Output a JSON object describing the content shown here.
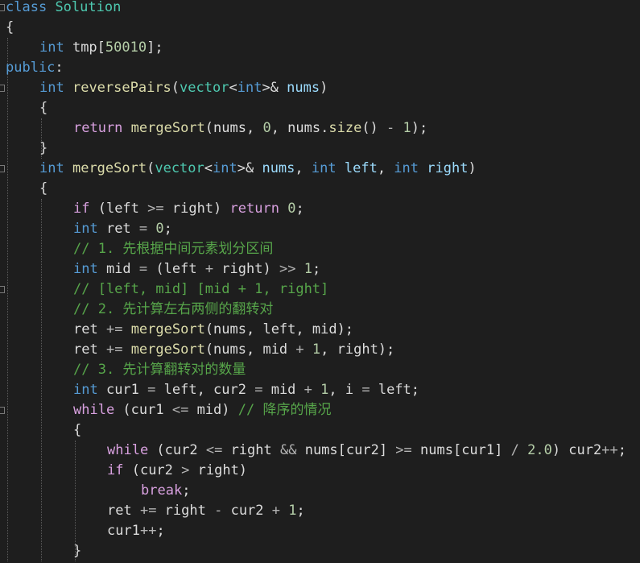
{
  "colors": {
    "background": "#1e1e1e",
    "keyword": "#569cd6",
    "control": "#d8a0df",
    "type": "#4ec9b0",
    "function": "#dcdcaa",
    "variable": "#9cdcfe",
    "number": "#b5cea8",
    "comment": "#57a64a",
    "operator": "#b4b4b4",
    "plain": "#dcdcdc"
  },
  "lines": [
    {
      "indent": 0,
      "fold": true,
      "tokens": [
        [
          "class",
          "kw"
        ],
        [
          " ",
          "plain"
        ],
        [
          "Solution",
          "type"
        ]
      ]
    },
    {
      "indent": 0,
      "fold": false,
      "tokens": [
        [
          "{",
          "plain"
        ]
      ]
    },
    {
      "indent": 1,
      "fold": false,
      "tokens": [
        [
          "int",
          "kw"
        ],
        [
          " tmp[",
          "plain"
        ],
        [
          "50010",
          "num"
        ],
        [
          "];",
          "plain"
        ]
      ]
    },
    {
      "indent": 0,
      "fold": false,
      "tokens": [
        [
          "public",
          "kw"
        ],
        [
          ":",
          "plain"
        ]
      ]
    },
    {
      "indent": 1,
      "fold": true,
      "tokens": [
        [
          "int",
          "kw"
        ],
        [
          " ",
          "plain"
        ],
        [
          "reversePairs",
          "fn"
        ],
        [
          "(",
          "plain"
        ],
        [
          "vector",
          "type"
        ],
        [
          "<",
          "plain"
        ],
        [
          "int",
          "kw"
        ],
        [
          ">& ",
          "plain"
        ],
        [
          "nums",
          "var"
        ],
        [
          ")",
          "plain"
        ]
      ]
    },
    {
      "indent": 1,
      "fold": false,
      "tokens": [
        [
          "{",
          "plain"
        ]
      ]
    },
    {
      "indent": 2,
      "fold": false,
      "tokens": [
        [
          "return",
          "ctl"
        ],
        [
          " ",
          "plain"
        ],
        [
          "mergeSort",
          "fn"
        ],
        [
          "(nums, ",
          "plain"
        ],
        [
          "0",
          "num"
        ],
        [
          ", nums.",
          "plain"
        ],
        [
          "size",
          "fn"
        ],
        [
          "() ",
          "plain"
        ],
        [
          "-",
          "op"
        ],
        [
          " ",
          "plain"
        ],
        [
          "1",
          "num"
        ],
        [
          ");",
          "plain"
        ]
      ]
    },
    {
      "indent": 1,
      "fold": false,
      "tokens": [
        [
          "}",
          "plain"
        ]
      ]
    },
    {
      "indent": 1,
      "fold": true,
      "tokens": [
        [
          "int",
          "kw"
        ],
        [
          " ",
          "plain"
        ],
        [
          "mergeSort",
          "fn"
        ],
        [
          "(",
          "plain"
        ],
        [
          "vector",
          "type"
        ],
        [
          "<",
          "plain"
        ],
        [
          "int",
          "kw"
        ],
        [
          ">& ",
          "plain"
        ],
        [
          "nums",
          "var"
        ],
        [
          ", ",
          "plain"
        ],
        [
          "int",
          "kw"
        ],
        [
          " ",
          "plain"
        ],
        [
          "left",
          "var"
        ],
        [
          ", ",
          "plain"
        ],
        [
          "int",
          "kw"
        ],
        [
          " ",
          "plain"
        ],
        [
          "right",
          "var"
        ],
        [
          ")",
          "plain"
        ]
      ]
    },
    {
      "indent": 1,
      "fold": false,
      "tokens": [
        [
          "{",
          "plain"
        ]
      ]
    },
    {
      "indent": 2,
      "fold": false,
      "tokens": [
        [
          "if",
          "ctl"
        ],
        [
          " (left ",
          "plain"
        ],
        [
          ">=",
          "op"
        ],
        [
          " right) ",
          "plain"
        ],
        [
          "return",
          "ctl"
        ],
        [
          " ",
          "plain"
        ],
        [
          "0",
          "num"
        ],
        [
          ";",
          "plain"
        ]
      ]
    },
    {
      "indent": 2,
      "fold": false,
      "tokens": [
        [
          "int",
          "kw"
        ],
        [
          " ret ",
          "plain"
        ],
        [
          "=",
          "op"
        ],
        [
          " ",
          "plain"
        ],
        [
          "0",
          "num"
        ],
        [
          ";",
          "plain"
        ]
      ]
    },
    {
      "indent": 2,
      "fold": false,
      "tokens": [
        [
          "// 1. 先根据中间元素划分区间",
          "cmt"
        ]
      ]
    },
    {
      "indent": 2,
      "fold": false,
      "tokens": [
        [
          "int",
          "kw"
        ],
        [
          " mid ",
          "plain"
        ],
        [
          "=",
          "op"
        ],
        [
          " (left ",
          "plain"
        ],
        [
          "+",
          "op"
        ],
        [
          " right) ",
          "plain"
        ],
        [
          ">>",
          "op"
        ],
        [
          " ",
          "plain"
        ],
        [
          "1",
          "num"
        ],
        [
          ";",
          "plain"
        ]
      ]
    },
    {
      "indent": 2,
      "fold": true,
      "tokens": [
        [
          "// [left, mid] [mid + 1, right]",
          "cmt"
        ]
      ]
    },
    {
      "indent": 2,
      "fold": false,
      "tokens": [
        [
          "// 2. 先计算左右两侧的翻转对",
          "cmt"
        ]
      ]
    },
    {
      "indent": 2,
      "fold": false,
      "tokens": [
        [
          "ret ",
          "plain"
        ],
        [
          "+=",
          "op"
        ],
        [
          " ",
          "plain"
        ],
        [
          "mergeSort",
          "fn"
        ],
        [
          "(nums, left, mid);",
          "plain"
        ]
      ]
    },
    {
      "indent": 2,
      "fold": false,
      "tokens": [
        [
          "ret ",
          "plain"
        ],
        [
          "+=",
          "op"
        ],
        [
          " ",
          "plain"
        ],
        [
          "mergeSort",
          "fn"
        ],
        [
          "(nums, mid ",
          "plain"
        ],
        [
          "+",
          "op"
        ],
        [
          " ",
          "plain"
        ],
        [
          "1",
          "num"
        ],
        [
          ", right);",
          "plain"
        ]
      ]
    },
    {
      "indent": 2,
      "fold": false,
      "tokens": [
        [
          "// 3. 先计算翻转对的数量",
          "cmt"
        ]
      ]
    },
    {
      "indent": 2,
      "fold": false,
      "tokens": [
        [
          "int",
          "kw"
        ],
        [
          " cur1 ",
          "plain"
        ],
        [
          "=",
          "op"
        ],
        [
          " left, cur2 ",
          "plain"
        ],
        [
          "=",
          "op"
        ],
        [
          " mid ",
          "plain"
        ],
        [
          "+",
          "op"
        ],
        [
          " ",
          "plain"
        ],
        [
          "1",
          "num"
        ],
        [
          ", i ",
          "plain"
        ],
        [
          "=",
          "op"
        ],
        [
          " left;",
          "plain"
        ]
      ]
    },
    {
      "indent": 2,
      "fold": true,
      "tokens": [
        [
          "while",
          "ctl"
        ],
        [
          " (cur1 ",
          "plain"
        ],
        [
          "<=",
          "op"
        ],
        [
          " mid) ",
          "plain"
        ],
        [
          "// 降序的情况",
          "cmt"
        ]
      ]
    },
    {
      "indent": 2,
      "fold": false,
      "tokens": [
        [
          "{",
          "plain"
        ]
      ]
    },
    {
      "indent": 3,
      "fold": false,
      "tokens": [
        [
          "while",
          "ctl"
        ],
        [
          " (cur2 ",
          "plain"
        ],
        [
          "<=",
          "op"
        ],
        [
          " right ",
          "plain"
        ],
        [
          "&&",
          "op"
        ],
        [
          " nums[cur2] ",
          "plain"
        ],
        [
          ">=",
          "op"
        ],
        [
          " nums[cur1] ",
          "plain"
        ],
        [
          "/",
          "op"
        ],
        [
          " ",
          "plain"
        ],
        [
          "2.0",
          "num"
        ],
        [
          ") cur2",
          "plain"
        ],
        [
          "++",
          "op"
        ],
        [
          ";",
          "plain"
        ]
      ]
    },
    {
      "indent": 3,
      "fold": false,
      "tokens": [
        [
          "if",
          "ctl"
        ],
        [
          " (cur2 ",
          "plain"
        ],
        [
          ">",
          "op"
        ],
        [
          " right)",
          "plain"
        ]
      ]
    },
    {
      "indent": 4,
      "fold": false,
      "tokens": [
        [
          "break",
          "ctl"
        ],
        [
          ";",
          "plain"
        ]
      ]
    },
    {
      "indent": 3,
      "fold": false,
      "tokens": [
        [
          "ret ",
          "plain"
        ],
        [
          "+=",
          "op"
        ],
        [
          " right ",
          "plain"
        ],
        [
          "-",
          "op"
        ],
        [
          " cur2 ",
          "plain"
        ],
        [
          "+",
          "op"
        ],
        [
          " ",
          "plain"
        ],
        [
          "1",
          "num"
        ],
        [
          ";",
          "plain"
        ]
      ]
    },
    {
      "indent": 3,
      "fold": false,
      "tokens": [
        [
          "cur1",
          "plain"
        ],
        [
          "++",
          "op"
        ],
        [
          ";",
          "plain"
        ]
      ]
    },
    {
      "indent": 2,
      "fold": false,
      "tokens": [
        [
          "}",
          "plain"
        ]
      ]
    }
  ]
}
